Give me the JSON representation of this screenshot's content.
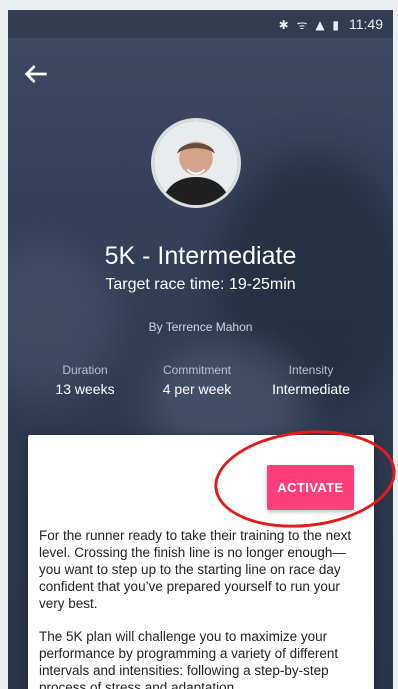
{
  "status_bar": {
    "icons": [
      "bluetooth-icon",
      "wifi-icon",
      "signal-icon",
      "battery-icon"
    ],
    "time": "11:49"
  },
  "nav": {
    "back_icon": "arrow-left-icon"
  },
  "plan": {
    "title": "5K - Intermediate",
    "target": "Target race time: 19-25min",
    "author": "By Terrence Mahon",
    "stats": [
      {
        "label": "Duration",
        "value": "13 weeks"
      },
      {
        "label": "Commitment",
        "value": "4 per week"
      },
      {
        "label": "Intensity",
        "value": "Intermediate"
      }
    ],
    "activate_label": "ACTIVATE",
    "description": [
      "For the runner ready to take their training to the next level. Crossing the finish line is no longer enough—you want to step up to the starting line on race day confident that you’ve prepared yourself to run your very best.",
      "The 5K plan will challenge you to maximize your performance by programming a variety of different intervals and intensities: following a step-by-step process of stress and adaptation"
    ]
  },
  "colors": {
    "accent": "#ff3f7b",
    "background": "#35415a",
    "annotation": "#e31b1b"
  }
}
